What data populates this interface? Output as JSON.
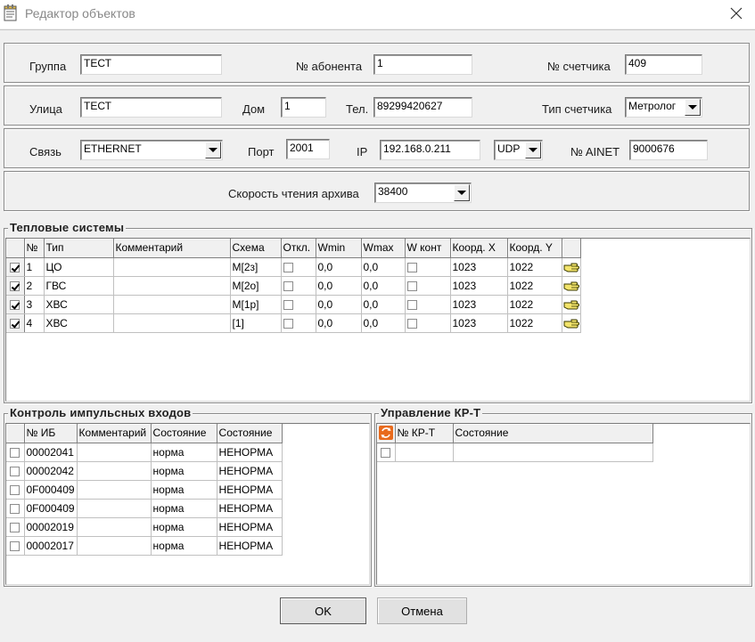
{
  "window": {
    "title": "Редактор объектов",
    "close_icon": "close-icon"
  },
  "row1": {
    "group_label": "Группа",
    "group_value": "ТЕСТ",
    "subscriber_label": "№ абонента",
    "subscriber_value": "1",
    "meter_label": "№ счетчика",
    "meter_value": "409"
  },
  "row2": {
    "street_label": "Улица",
    "street_value": "ТЕСТ",
    "house_label": "Дом",
    "house_value": "1",
    "phone_label": "Тел.",
    "phone_value": "89299420627",
    "meter_type_label": "Тип счетчика",
    "meter_type_value": "Метролог"
  },
  "row3": {
    "link_label": "Связь",
    "link_value": "ETHERNET",
    "port_label": "Порт",
    "port_value": "2001",
    "ip_label": "IP",
    "ip_value": "192.168.0.211",
    "protocol_value": "UDP",
    "ainet_label": "№ AINET",
    "ainet_value": "9000676"
  },
  "row4": {
    "speed_label": "Скорость чтения архива",
    "speed_value": "38400"
  },
  "heat_systems": {
    "title": "Тепловые системы",
    "columns": [
      "№",
      "Тип",
      "Комментарий",
      "Схема",
      "Откл.",
      "Wmin",
      "Wmax",
      "W конт",
      "Коорд. X",
      "Коорд. Y"
    ],
    "rows": [
      {
        "checked": true,
        "num": "1",
        "type": "ЦО",
        "comment": "",
        "scheme": "М[2з]",
        "off": false,
        "wmin": "0,0",
        "wmax": "0,0",
        "wcont": false,
        "x": "1023",
        "y": "1022",
        "icon": "hand-pointer-icon"
      },
      {
        "checked": true,
        "num": "2",
        "type": "ГВС",
        "comment": "",
        "scheme": "М[2о]",
        "off": false,
        "wmin": "0,0",
        "wmax": "0,0",
        "wcont": false,
        "x": "1023",
        "y": "1022",
        "icon": "hand-pointer-icon"
      },
      {
        "checked": true,
        "num": "3",
        "type": "ХВС",
        "comment": "",
        "scheme": "М[1р]",
        "off": false,
        "wmin": "0,0",
        "wmax": "0,0",
        "wcont": false,
        "x": "1023",
        "y": "1022",
        "icon": "hand-pointer-icon"
      },
      {
        "checked": true,
        "num": "4",
        "type": "ХВС",
        "comment": "",
        "scheme": "[1]",
        "off": false,
        "wmin": "0,0",
        "wmax": "0,0",
        "wcont": false,
        "x": "1023",
        "y": "1022",
        "icon": "hand-pointer-icon"
      }
    ]
  },
  "pulse": {
    "title": "Контроль импульсных входов",
    "columns": [
      "№ ИБ",
      "Комментарий",
      "Состояние",
      "Состояние"
    ],
    "rows": [
      {
        "id": "00002041",
        "comment": "",
        "state1": "норма",
        "state2": "НЕНОРМА"
      },
      {
        "id": "00002042",
        "comment": "",
        "state1": "норма",
        "state2": "НЕНОРМА"
      },
      {
        "id": "0F000409",
        "comment": "",
        "state1": "норма",
        "state2": "НЕНОРМА"
      },
      {
        "id": "0F000409",
        "comment": "",
        "state1": "норма",
        "state2": "НЕНОРМА"
      },
      {
        "id": "00002019",
        "comment": "",
        "state1": "норма",
        "state2": "НЕНОРМА"
      },
      {
        "id": "00002017",
        "comment": "",
        "state1": "норма",
        "state2": "НЕНОРМА"
      }
    ]
  },
  "krt": {
    "title": "Управление КР-Т",
    "columns": [
      "№ КР-Т",
      "Состояние"
    ],
    "refresh_icon": "refresh-icon"
  },
  "buttons": {
    "ok": "OK",
    "cancel": "Отмена"
  }
}
